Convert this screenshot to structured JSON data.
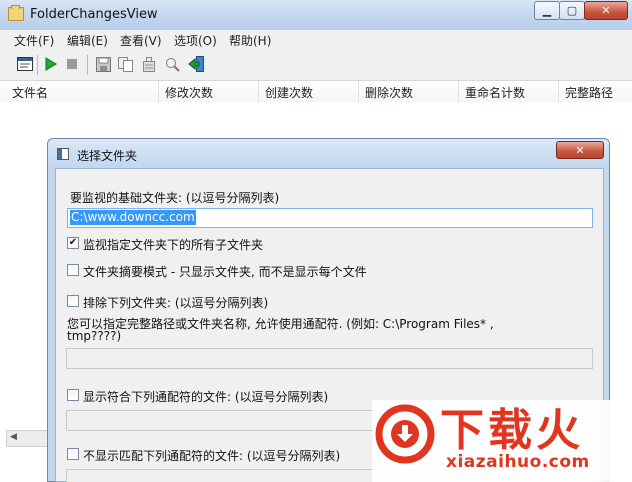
{
  "window": {
    "title": "FolderChangesView"
  },
  "menu": [
    "文件(F)",
    "编辑(E)",
    "查看(V)",
    "选项(O)",
    "帮助(H)"
  ],
  "columns": [
    "文件名",
    "修改次数",
    "创建次数",
    "删除次数",
    "重命名计数",
    "完整路径"
  ],
  "dialog": {
    "title": "选择文件夹",
    "base_label": "要监视的基础文件夹: (以逗号分隔列表)",
    "base_value": "C:\\www.downcc.com",
    "opt_subfolders": {
      "label": "监视指定文件夹下的所有子文件夹",
      "checked": true
    },
    "opt_summary": {
      "label": "文件夹摘要模式 - 只显示文件夹, 而不是显示每个文件",
      "checked": false
    },
    "opt_exclude": {
      "label": "排除下列文件夹: (以逗号分隔列表)",
      "checked": false
    },
    "exclude_hint_line1": "您可以指定完整路径或文件夹名称, 允许使用通配符. (例如: C:\\Program Files* ,",
    "exclude_hint_line2": "tmp????)",
    "opt_show_matching": {
      "label": "显示符合下列通配符的文件: (以逗号分隔列表)",
      "checked": false
    },
    "opt_hide_matching": {
      "label": "不显示匹配下列通配符的文件: (以逗号分隔列表)",
      "checked": false
    }
  },
  "watermark": {
    "brand": "下载火",
    "url": "xiazaihuo.com"
  },
  "colors": {
    "accent": "#3399ff",
    "watermark": "#e0351f"
  }
}
